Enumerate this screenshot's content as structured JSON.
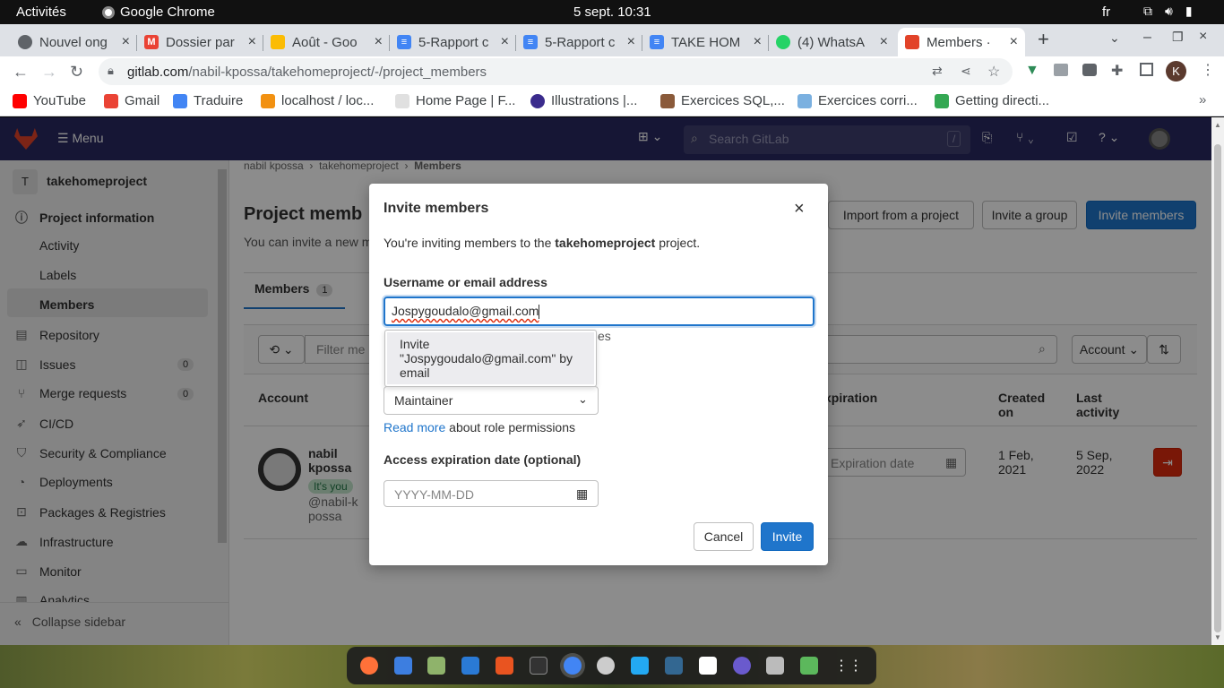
{
  "os": {
    "activities": "Activités",
    "app_name": "Google Chrome",
    "clock": "5 sept.  10:31",
    "lang": "fr"
  },
  "tabs": [
    {
      "title": "Nouvel ong",
      "icon": "chrome-icon",
      "color": "#5f6368"
    },
    {
      "title": "Dossier par",
      "icon": "gmail-icon",
      "color": "#ea4335"
    },
    {
      "title": "Août - Goo",
      "icon": "drive-icon",
      "color": "#fbbc04"
    },
    {
      "title": "5-Rapport c",
      "icon": "docs-icon",
      "color": "#4285f4"
    },
    {
      "title": "5-Rapport c",
      "icon": "docs-icon",
      "color": "#4285f4"
    },
    {
      "title": "TAKE HOM",
      "icon": "docs-icon",
      "color": "#4285f4"
    },
    {
      "title": "(4) WhatsA",
      "icon": "whatsapp-icon",
      "color": "#25d366"
    },
    {
      "title": "Members · ",
      "icon": "gitlab-icon",
      "color": "#e24329"
    }
  ],
  "omnibox": {
    "domain": "gitlab.com",
    "path": "/nabil-kpossa/takehomeproject/-/project_members"
  },
  "profile_initial": "K",
  "bookmarks": [
    {
      "label": "YouTube",
      "color": "#ff0000"
    },
    {
      "label": "Gmail",
      "color": "#ea4335"
    },
    {
      "label": "Traduire",
      "color": "#4285f4"
    },
    {
      "label": "localhost / loc...",
      "color": "#f29111"
    },
    {
      "label": "Home Page | F...",
      "color": "#e0e0e0"
    },
    {
      "label": "Illustrations |...",
      "color": "#3a2b8c"
    },
    {
      "label": "Exercices SQL,...",
      "color": "#8a5a3a"
    },
    {
      "label": "Exercices corri...",
      "color": "#7ab0e0"
    },
    {
      "label": "Getting directi...",
      "color": "#34a853"
    }
  ],
  "gitlab": {
    "menu": "Menu",
    "search_placeholder": "Search GitLab",
    "search_shortcut": "/",
    "breadcrumb": [
      "nabil kpossa",
      "takehomeproject",
      "Members"
    ],
    "project_initial": "T",
    "project_name": "takehomeproject",
    "sidebar": {
      "project_information": "Project information",
      "sub_items": [
        "Activity",
        "Labels",
        "Members"
      ],
      "items": [
        {
          "label": "Repository",
          "icon": "book-icon"
        },
        {
          "label": "Issues",
          "icon": "issues-icon",
          "count": "0"
        },
        {
          "label": "Merge requests",
          "icon": "merge-request-icon",
          "count": "0"
        },
        {
          "label": "CI/CD",
          "icon": "rocket-icon"
        },
        {
          "label": "Security & Compliance",
          "icon": "shield-icon"
        },
        {
          "label": "Deployments",
          "icon": "deployments-icon"
        },
        {
          "label": "Packages & Registries",
          "icon": "package-icon"
        },
        {
          "label": "Infrastructure",
          "icon": "cloud-icon"
        },
        {
          "label": "Monitor",
          "icon": "monitor-icon"
        },
        {
          "label": "Analytics",
          "icon": "chart-icon"
        }
      ],
      "collapse": "Collapse sidebar"
    },
    "page_title": "Project memb",
    "intro": "You can invite a new m",
    "buttons": {
      "import": "Import from a project",
      "invite_group": "Invite a group",
      "invite_members": "Invite members"
    },
    "members_tab": "Members",
    "members_count": "1",
    "filter_placeholder": "Filter me",
    "sort_label": "Account",
    "table": {
      "col_account": "Account",
      "col_expiration": "xpiration",
      "col_created": "Created on",
      "col_activity": "Last activity",
      "row": {
        "name": "nabil kpossa",
        "badge": "It's you",
        "handle": "@nabil-kpossa",
        "expiration_placeholder": "Expiration date",
        "created": "1 Feb, 2021",
        "last_activity": "5 Sep, 2022"
      }
    }
  },
  "modal": {
    "title": "Invite members",
    "intro_prefix": "You're inviting members to the ",
    "intro_project": "takehomeproject",
    "intro_suffix": " project.",
    "username_label": "Username or email address",
    "username_value": "Jospygoudalo@gmail.com",
    "hidden_hint_tail": "es",
    "dropdown_option": "Invite \"Jospygoudalo@gmail.com\" by email",
    "role_value": "Maintainer",
    "read_more": "Read more",
    "read_more_suffix": " about role permissions",
    "expiration_label": "Access expiration date (optional)",
    "expiration_placeholder": "YYYY-MM-DD",
    "cancel": "Cancel",
    "invite": "Invite"
  }
}
